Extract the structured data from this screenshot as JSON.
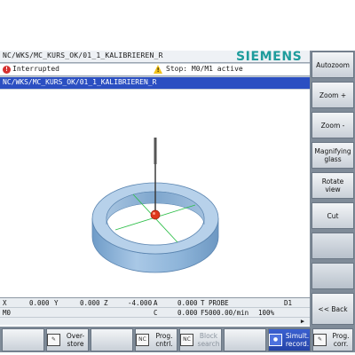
{
  "header": {
    "path": "NC/WKS/MC_KURS_OK/01_1_KALIBRIEREN_R",
    "brand": "SIEMENS"
  },
  "status": {
    "left_text": "Interrupted",
    "alarm_text": "Stop: M0/M1 active"
  },
  "program": {
    "path": "NC/WKS/MC_KURS_OK/01_1_KALIBRIEREN_R"
  },
  "data_line_1": {
    "x_label": "X",
    "x_value": "0.000",
    "y_label": "Y",
    "y_value": "0.000",
    "z_label": "Z",
    "z_value": "-4.000",
    "a_label": "A",
    "a_value": "0.000",
    "tool": "T PROBE",
    "d": "D1"
  },
  "data_line_2": {
    "m": "M0",
    "c_label": "C",
    "c_value": "0.000",
    "feed": "F5000.00/min",
    "override": "100%"
  },
  "vertical_softkeys": [
    {
      "label": "Autozoom"
    },
    {
      "label": "Zoom +"
    },
    {
      "label": "Zoom -"
    },
    {
      "label": "Magnifying glass"
    },
    {
      "label": "Rotate view"
    },
    {
      "label": "Cut"
    },
    {
      "label": ""
    },
    {
      "label": ""
    },
    {
      "label": "<< Back"
    }
  ],
  "horizontal_softkeys": [
    {
      "label": "",
      "icon": ""
    },
    {
      "label": "Over-store",
      "icon": "overstore-icon"
    },
    {
      "label": "",
      "icon": ""
    },
    {
      "label": "Prog. cntrl.",
      "icon": "prog-control-icon"
    },
    {
      "label": "Block search",
      "icon": "block-search-icon",
      "disabled": true
    },
    {
      "label": "",
      "icon": ""
    },
    {
      "label": "Simult. record.",
      "icon": "simult-record-icon",
      "active": true
    },
    {
      "label": "Prog. corr.",
      "icon": "prog-corr-icon"
    }
  ],
  "colors": {
    "brand": "#1e9c9c",
    "program_bar": "#2b4fc2",
    "ring": "#8fb6dc",
    "probe_ball": "#e0381c"
  }
}
